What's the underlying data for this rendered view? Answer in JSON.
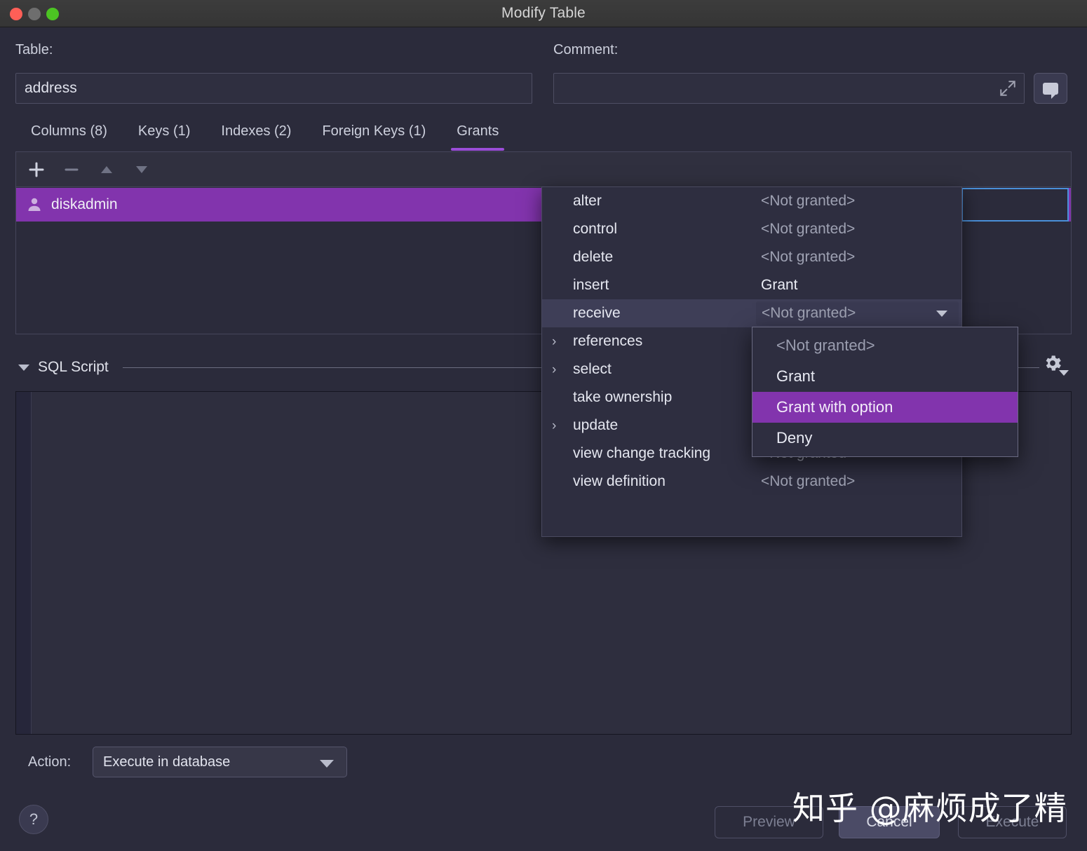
{
  "window": {
    "title": "Modify Table",
    "traffic_lights": [
      "close-red",
      "minimize-gray",
      "zoom-green"
    ]
  },
  "form": {
    "table_label": "Table:",
    "table_value": "address",
    "comment_label": "Comment:",
    "comment_value": "",
    "comment_placeholder": "",
    "expand_icon": "expand-arrows-icon",
    "comment_button_icon": "speech-bubble-icon"
  },
  "tabs": [
    {
      "label": "Columns (8)",
      "active": false
    },
    {
      "label": "Keys (1)",
      "active": false
    },
    {
      "label": "Indexes (2)",
      "active": false
    },
    {
      "label": "Foreign Keys (1)",
      "active": false
    },
    {
      "label": "Grants",
      "active": true
    }
  ],
  "grants_toolbar": {
    "add_icon": "plus-icon",
    "remove_icon": "minus-icon",
    "move_up_icon": "arrow-up-icon",
    "move_down_icon": "arrow-down-icon"
  },
  "grants_table": {
    "rows": [
      {
        "icon": "user-icon",
        "name": "diskadmin",
        "selected": true
      }
    ]
  },
  "permissions_menu": {
    "items": [
      {
        "name": "alter",
        "value": "<Not granted>",
        "expandable": false,
        "highlighted": false,
        "granted": false
      },
      {
        "name": "control",
        "value": "<Not granted>",
        "expandable": false,
        "highlighted": false,
        "granted": false
      },
      {
        "name": "delete",
        "value": "<Not granted>",
        "expandable": false,
        "highlighted": false,
        "granted": false
      },
      {
        "name": "insert",
        "value": "Grant",
        "expandable": false,
        "highlighted": false,
        "granted": true
      },
      {
        "name": "receive",
        "value": "<Not granted>",
        "expandable": false,
        "highlighted": true,
        "granted": false,
        "editing": true
      },
      {
        "name": "references",
        "value": "",
        "expandable": true,
        "highlighted": false,
        "granted": false
      },
      {
        "name": "select",
        "value": "",
        "expandable": true,
        "highlighted": false,
        "granted": false
      },
      {
        "name": "take ownership",
        "value": "",
        "expandable": false,
        "highlighted": false,
        "granted": false
      },
      {
        "name": "update",
        "value": "",
        "expandable": true,
        "highlighted": false,
        "granted": false
      },
      {
        "name": "view change tracking",
        "value": "<Not granted>",
        "expandable": false,
        "highlighted": false,
        "granted": false
      },
      {
        "name": "view definition",
        "value": "<Not granted>",
        "expandable": false,
        "highlighted": false,
        "granted": false
      }
    ],
    "chevron_glyph": "›"
  },
  "grant_dropdown": {
    "options": [
      {
        "label": "<Not granted>",
        "selected": false,
        "muted": true
      },
      {
        "label": "Grant",
        "selected": false,
        "muted": false
      },
      {
        "label": "Grant with option",
        "selected": true,
        "muted": false
      },
      {
        "label": "Deny",
        "selected": false,
        "muted": false
      }
    ]
  },
  "sql_script": {
    "title": "SQL Script",
    "collapse_icon": "triangle-down-icon",
    "settings_icon": "gear-icon",
    "content": ""
  },
  "action_bar": {
    "label": "Action:",
    "selected": "Execute in database",
    "help_label": "?"
  },
  "buttons": {
    "preview": "Preview",
    "cancel": "Cancel",
    "execute": "Execute"
  },
  "watermark": {
    "text": "知乎 @麻烦成了精"
  },
  "colors": {
    "window_bg": "#2b2b3b",
    "titlebar": "#3c3c3c",
    "accent_purple": "#8234ad",
    "tab_underline": "#9b4dd8",
    "focus_blue": "#4a90d9",
    "text_primary": "#e0e2ec",
    "text_muted": "#9fa2b3"
  }
}
